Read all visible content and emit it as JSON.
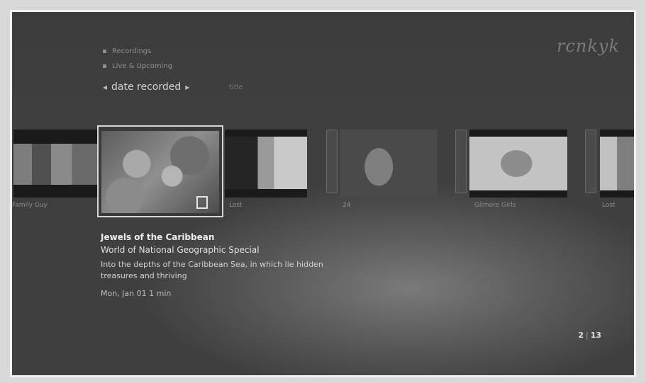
{
  "app": {
    "logo_text": "rcnkyk"
  },
  "menu": {
    "items": [
      {
        "label": "Recordings",
        "icon": "square-bullet-icon"
      },
      {
        "label": "Live & Upcoming",
        "icon": "square-bullet-icon"
      }
    ],
    "sort": {
      "label": "date recorded",
      "left_arrow": "◂",
      "right_arrow": "▸",
      "hint": "title"
    }
  },
  "carousel": {
    "items": [
      {
        "label": "Family Guy"
      },
      {
        "label": "Jewels of the Caribbean",
        "selected": true
      },
      {
        "label": "Lost"
      },
      {
        "label": "24"
      },
      {
        "label": "Gilmore Girls"
      },
      {
        "label": "Lost"
      }
    ]
  },
  "details": {
    "title": "Jewels of the Caribbean",
    "subtitle": "World of National Geographic Special",
    "description": "Into the depths of the Caribbean Sea, in which lie hidden treasures and thriving",
    "meta": "Mon, Jan 01   1 min"
  },
  "pager": {
    "current": "2",
    "total": "13",
    "separator": "|"
  },
  "colors": {
    "background": "#3f3f3f",
    "selection_border": "#d6d6d6",
    "text": "#ededed"
  }
}
